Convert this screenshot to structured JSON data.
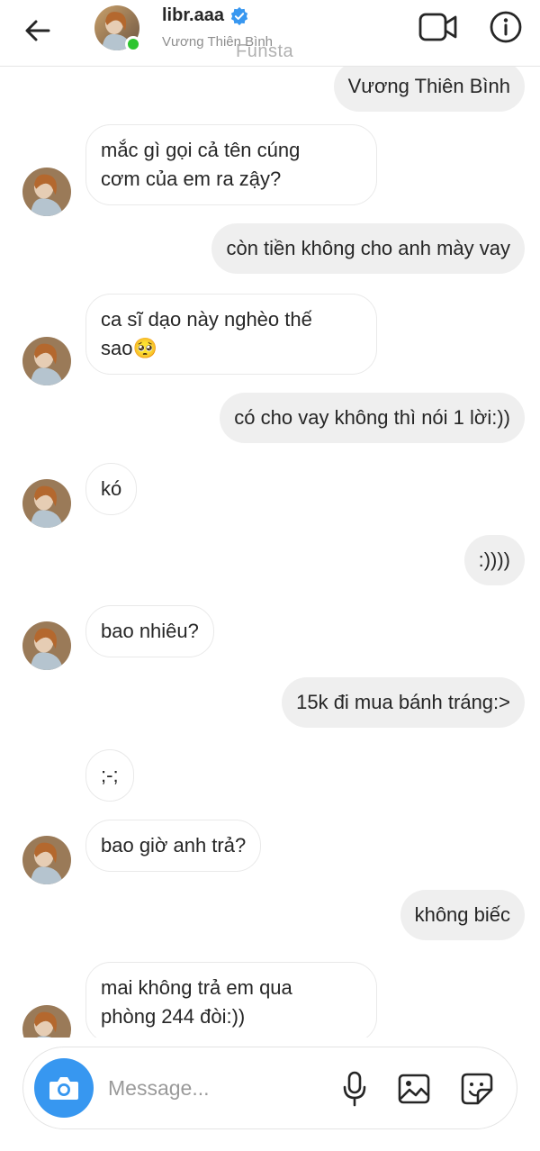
{
  "header": {
    "username": "libr.aaa",
    "full_name": "Vương Thiên Bình",
    "brand": "Funsta",
    "icons": {
      "back": "arrow-left-icon",
      "verified": "verified-badge-icon",
      "video": "video-camera-icon",
      "info": "info-icon"
    },
    "colors": {
      "verified": "#3897f0",
      "online": "#2dc52f"
    }
  },
  "messages": [
    {
      "from": "me",
      "text": "Vương Thiên Bình"
    },
    {
      "from": "them",
      "text": "mắc gì gọi cả tên cúng\ncơm của em ra zậy?"
    },
    {
      "from": "me",
      "text": "còn tiền không cho anh mày vay"
    },
    {
      "from": "them",
      "text": "ca sĩ dạo này nghèo thế\nsao🥺"
    },
    {
      "from": "me",
      "text": "có cho vay không thì nói 1 lời:))"
    },
    {
      "from": "them",
      "text": "kó"
    },
    {
      "from": "me",
      "text": ":))))"
    },
    {
      "from": "them",
      "text": "bao nhiêu?"
    },
    {
      "from": "me",
      "text": "15k đi mua bánh tráng:>"
    },
    {
      "from": "them",
      "text": ";-;"
    },
    {
      "from": "them",
      "text": "bao giờ anh trả?"
    },
    {
      "from": "me",
      "text": "không biếc"
    },
    {
      "from": "them",
      "text": "mai không trả em qua\nphòng 244 đòi:))"
    }
  ],
  "composer": {
    "placeholder": "Message...",
    "value": "",
    "icons": {
      "camera": "camera-icon",
      "mic": "microphone-icon",
      "gallery": "gallery-icon",
      "sticker": "sticker-icon"
    },
    "colors": {
      "camera_button": "#3797f0"
    }
  }
}
